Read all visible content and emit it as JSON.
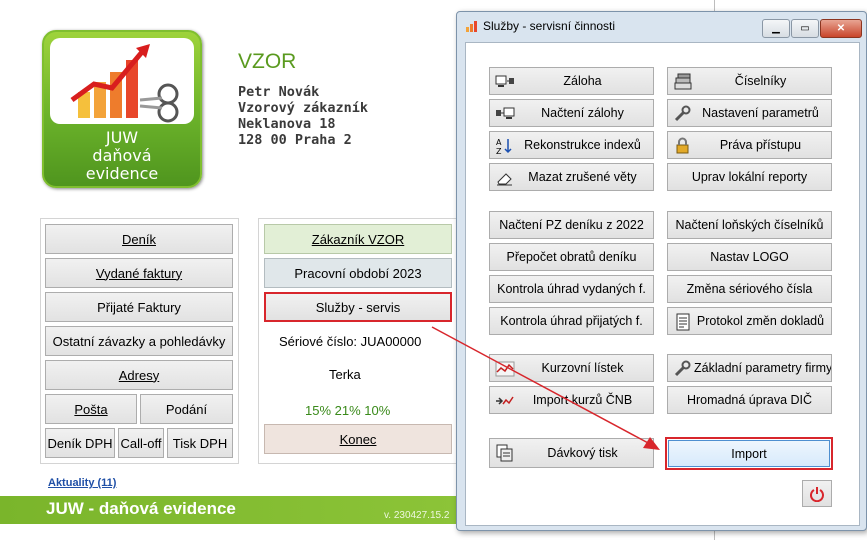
{
  "main": {
    "logo": {
      "line1": "JUW",
      "line2": "daňová",
      "line3": "evidence"
    },
    "company": "VZOR",
    "address": [
      "Petr Novák",
      "Vzorový zákazník",
      "Neklanova 18",
      "128 00 Praha 2"
    ],
    "left_buttons": {
      "denik": "Deník",
      "vydane": "Vydané faktury",
      "prijate": "Přijaté Faktury",
      "ostatni": "Ostatní závazky a pohledávky",
      "adresy": "Adresy",
      "posta": "Pošta",
      "podani": "Podání",
      "denik_dph": "Deník DPH",
      "calloff": "Call-off",
      "tisk_dph": "Tisk DPH"
    },
    "right_buttons": {
      "zakaznik": "Zákazník  VZOR",
      "obdobi": "Pracovní období 2023",
      "sluzby": "Služby - servis",
      "konec": "Konec"
    },
    "serial": "Sériové číslo: JUA00000",
    "user": "Terka",
    "vat": "15% 21% 10%",
    "news_link": "Aktuality (11)",
    "footer_title": "JUW - daňová evidence",
    "version": "v. 230427.15.2"
  },
  "dialog": {
    "title": "Služby - servisní činnosti",
    "buttons": {
      "zaloha": "Záloha",
      "ciselniky": "Číselníky",
      "nacteni_zalohy": "Načtení zálohy",
      "nastaveni": "Nastavení parametrů",
      "rekonstrukce": "Rekonstrukce indexů",
      "prava": "Práva přístupu",
      "mazat": "Mazat zrušené věty",
      "uprav": "Uprav lokální reporty",
      "pz": "Načtení PZ deníku z 2022",
      "lonskych": "Načtení loňských číselníků",
      "prepocet": "Přepočet obratů deníku",
      "logo": "Nastav LOGO",
      "kontrola_vyd": "Kontrola úhrad vydaných f.",
      "zmena_serial": "Změna sériového čísla",
      "kontrola_prij": "Kontrola úhrad přijatých f.",
      "protokol": "Protokol změn dokladů",
      "kurzovni": "Kurzovní lístek",
      "zakladni": "Základní parametry firmy",
      "import_kurzu": "Import kurzů ČNB",
      "dic": "Hromadná úprava DIČ",
      "davkovy": "Dávkový tisk",
      "import": "Import"
    }
  },
  "colors": {
    "accent_green": "#7ab52b",
    "highlight_red": "#d8262c",
    "dialog_bg": "#d9e4ef"
  }
}
